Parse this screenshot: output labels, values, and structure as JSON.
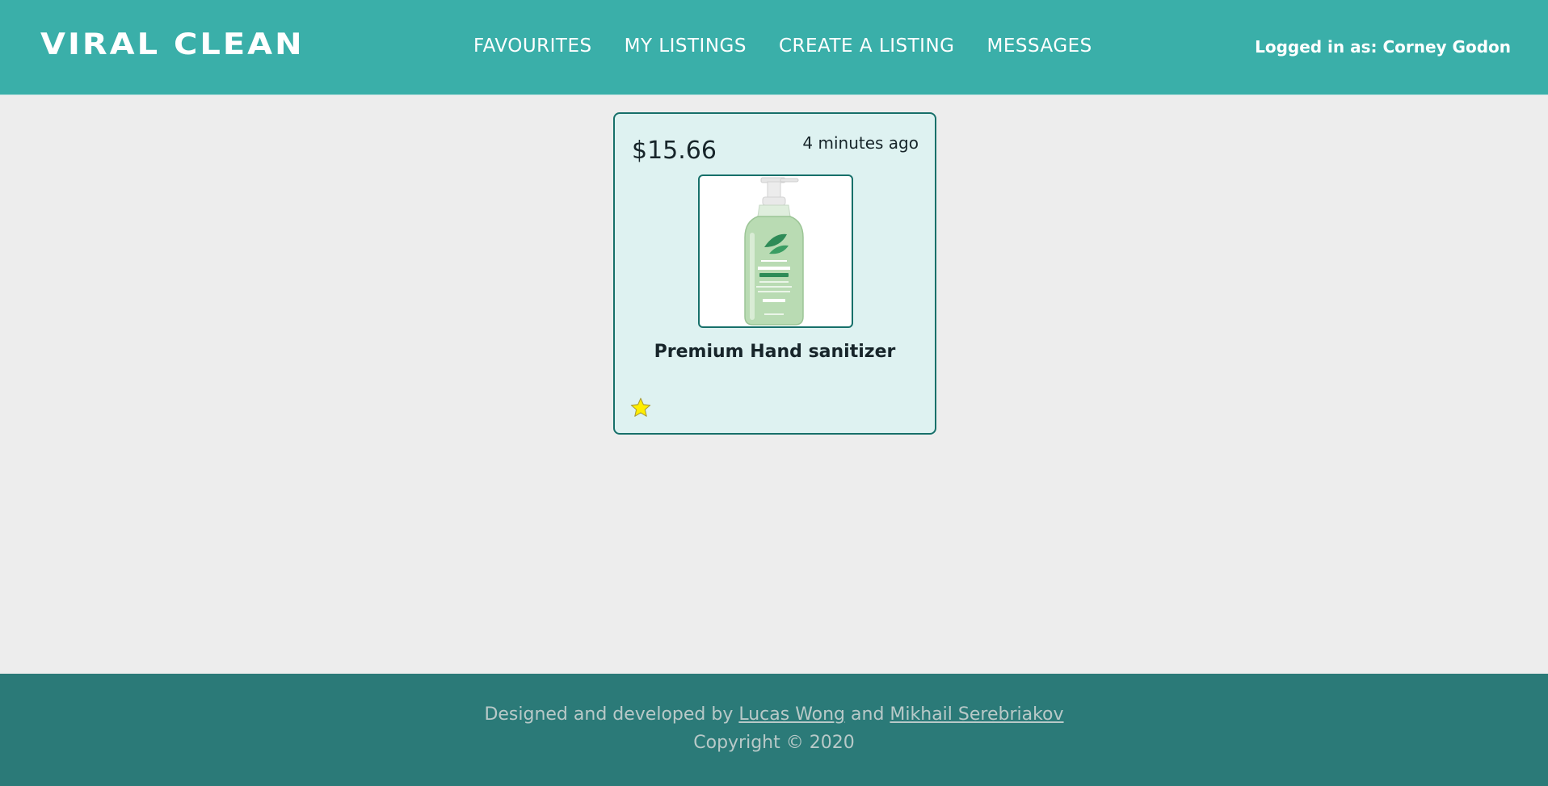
{
  "header": {
    "logo": "VIRAL CLEAN",
    "nav": [
      "FAVOURITES",
      "MY LISTINGS",
      "CREATE A LISTING",
      "MESSAGES"
    ],
    "login_status": "Logged in as: Corney Godon"
  },
  "listing": {
    "price": "$15.66",
    "posted": "4 minutes ago",
    "title": "Premium Hand sanitizer",
    "favourited": true
  },
  "footer": {
    "prefix": "Designed and developed by ",
    "author1": "Lucas Wong",
    "joiner": " and ",
    "author2": "Mikhail Serebriakov",
    "copyright": "Copyright © 2020"
  },
  "colors": {
    "header_bg": "#3aafa9",
    "card_bg": "#def2f1",
    "footer_bg": "#2b7a78",
    "star_fill": "#ffee00"
  }
}
